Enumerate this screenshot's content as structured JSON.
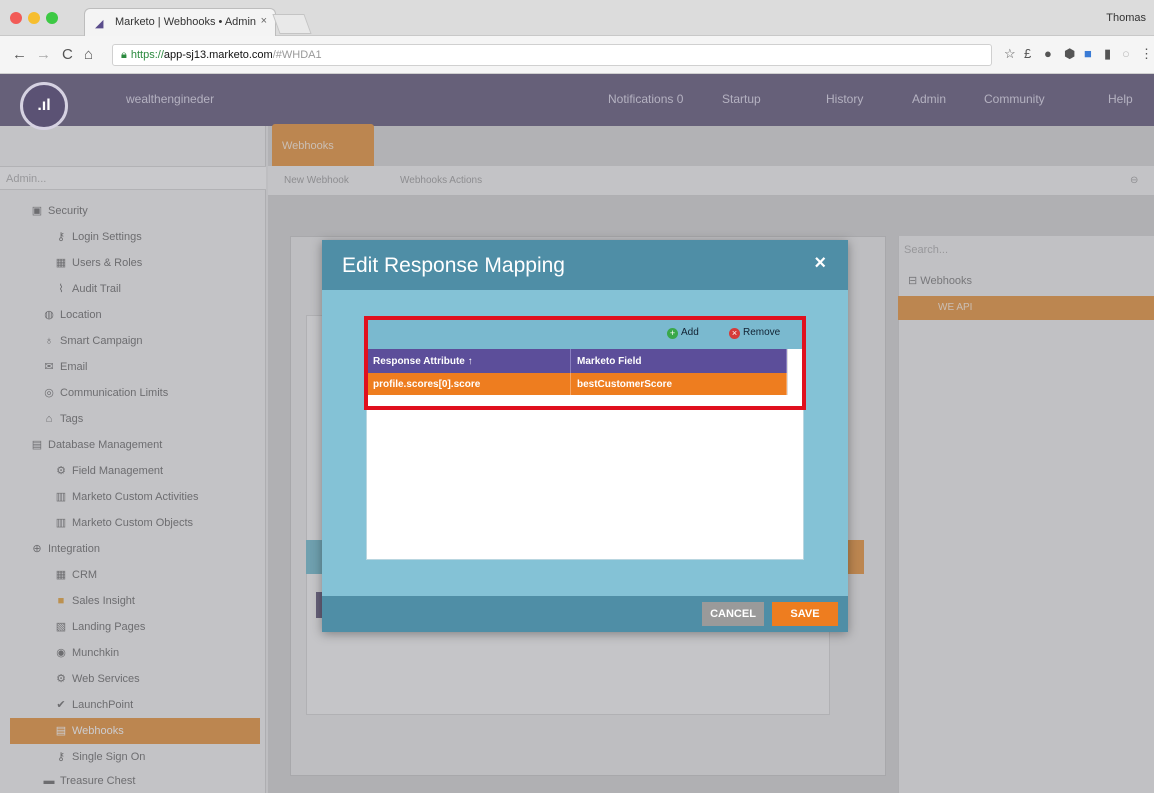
{
  "browser": {
    "tab_title": "Marketo | Webhooks • Admin",
    "tab_close": "×",
    "profile_name": "Thomas",
    "url_scheme": "https://",
    "url_host": "app-sj13.marketo.com",
    "url_hash": "/#WHDA1",
    "back": "←",
    "forward": "→",
    "reload": "C",
    "home": "⌂"
  },
  "topnav": {
    "logo": ".ıl",
    "workspace": "wealthengineder",
    "links": [
      "Notifications 0",
      "Startup",
      "History",
      "Admin",
      "Community",
      "Help"
    ]
  },
  "sidebar": {
    "search_placeholder": "Admin...",
    "items": [
      {
        "label": "Security",
        "icon": "lock-icon"
      },
      {
        "label": "Login Settings",
        "icon": "key-icon"
      },
      {
        "label": "Users & Roles",
        "icon": "users-icon"
      },
      {
        "label": "Audit Trail",
        "icon": "trail-icon"
      },
      {
        "label": "Location",
        "icon": "globe-icon"
      },
      {
        "label": "Smart Campaign",
        "icon": "bulb-icon"
      },
      {
        "label": "Email",
        "icon": "email-icon"
      },
      {
        "label": "Communication Limits",
        "icon": "limit-icon"
      },
      {
        "label": "Tags",
        "icon": "tag-icon"
      },
      {
        "label": "Database Management",
        "icon": "database-icon"
      },
      {
        "label": "Field Management",
        "icon": "field-icon"
      },
      {
        "label": "Marketo Custom Activities",
        "icon": "activity-icon"
      },
      {
        "label": "Marketo Custom Objects",
        "icon": "object-icon"
      },
      {
        "label": "Integration",
        "icon": "integration-icon"
      },
      {
        "label": "CRM",
        "icon": "crm-icon"
      },
      {
        "label": "Sales Insight",
        "icon": "insight-icon"
      },
      {
        "label": "Landing Pages",
        "icon": "page-icon"
      },
      {
        "label": "Munchkin",
        "icon": "munchkin-icon"
      },
      {
        "label": "Web Services",
        "icon": "service-icon"
      },
      {
        "label": "LaunchPoint",
        "icon": "launch-icon"
      },
      {
        "label": "Webhooks",
        "icon": "webhook-icon"
      },
      {
        "label": "Single Sign On",
        "icon": "sso-icon"
      },
      {
        "label": "Treasure Chest",
        "icon": "chest-icon"
      }
    ]
  },
  "main": {
    "tab_label": "Webhooks",
    "new_webhook": "New Webhook",
    "webhooks_actions": "Webhooks Actions",
    "right_search": "Search...",
    "right_tree_root": "Webhooks",
    "right_tree_item": "WE API"
  },
  "modal": {
    "title": "Edit Response Mapping",
    "close": "×",
    "add_label": "Add",
    "remove_label": "Remove",
    "columns": [
      "Response Attribute",
      "Marketo Field"
    ],
    "rows": [
      [
        "profile.scores[0].score",
        "bestCustomerScore"
      ]
    ],
    "cancel_label": "CANCEL",
    "save_label": "SAVE"
  },
  "colors": {
    "nav_purple": "#5b5274",
    "accent_orange": "#ee7d1f",
    "modal_header": "#4f8ea6",
    "grid_header": "#5c4e9a",
    "highlight_red": "#e0101e"
  }
}
